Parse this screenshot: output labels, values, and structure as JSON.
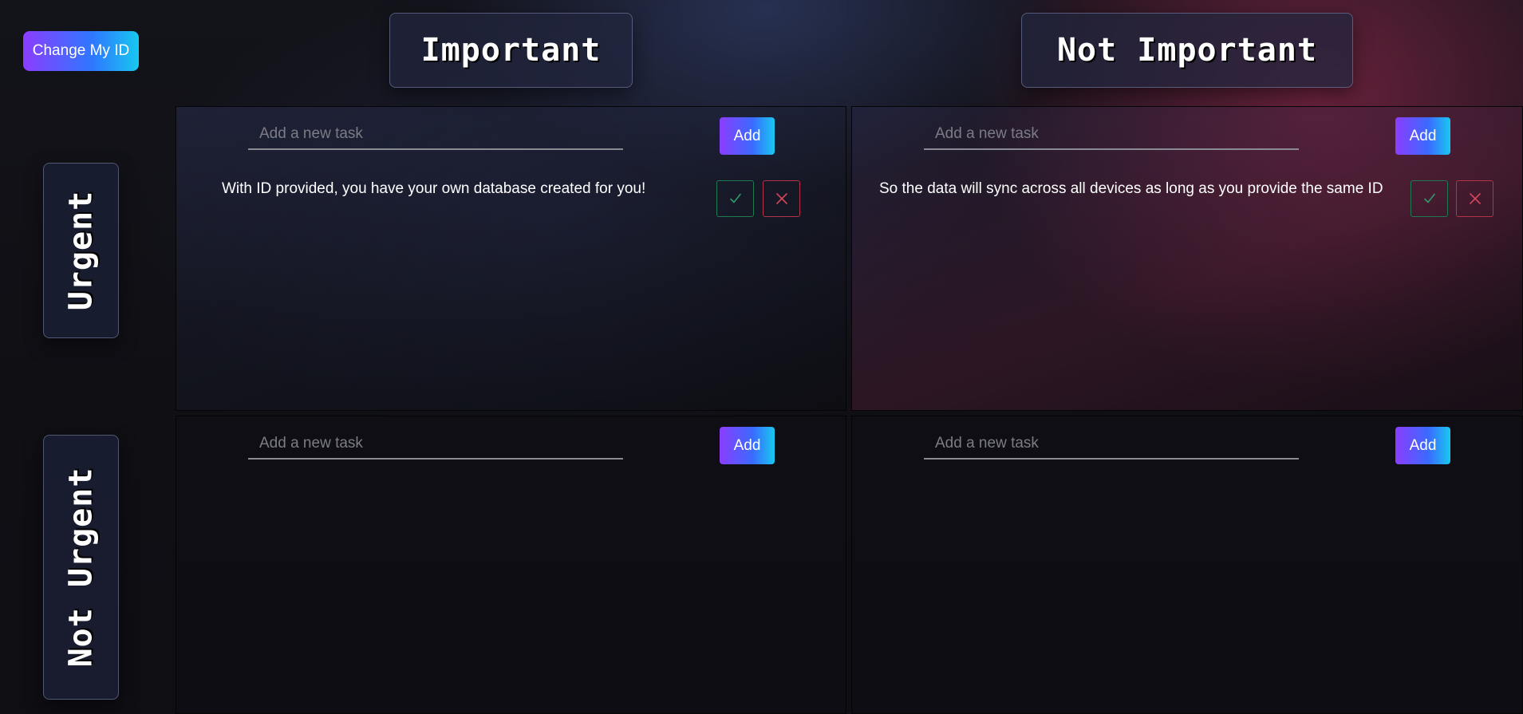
{
  "id_button": {
    "label": "Change My ID"
  },
  "columns": {
    "important": "Important",
    "not_important": "Not Important"
  },
  "rows": {
    "urgent": "Urgent",
    "not_urgent": "Not Urgent"
  },
  "input": {
    "placeholder": "Add a new task"
  },
  "add_button": {
    "label": "Add"
  },
  "quadrants": {
    "urgent_important": {
      "tasks": [
        {
          "text": "With ID provided, you have your own database created for you!"
        }
      ]
    },
    "urgent_not_important": {
      "tasks": [
        {
          "text": "So the data will sync across all devices as long as you provide the same ID"
        }
      ]
    },
    "not_urgent_important": {
      "tasks": []
    },
    "not_urgent_not_important": {
      "tasks": []
    }
  },
  "icons": {
    "complete": "check-icon",
    "delete": "close-icon"
  },
  "colors": {
    "background": "#0f0f14",
    "accent_gradient_start": "#8b3dff",
    "accent_gradient_end": "#18c8f0",
    "complete_green": "#2f9a6a",
    "delete_red": "#d7455c"
  }
}
